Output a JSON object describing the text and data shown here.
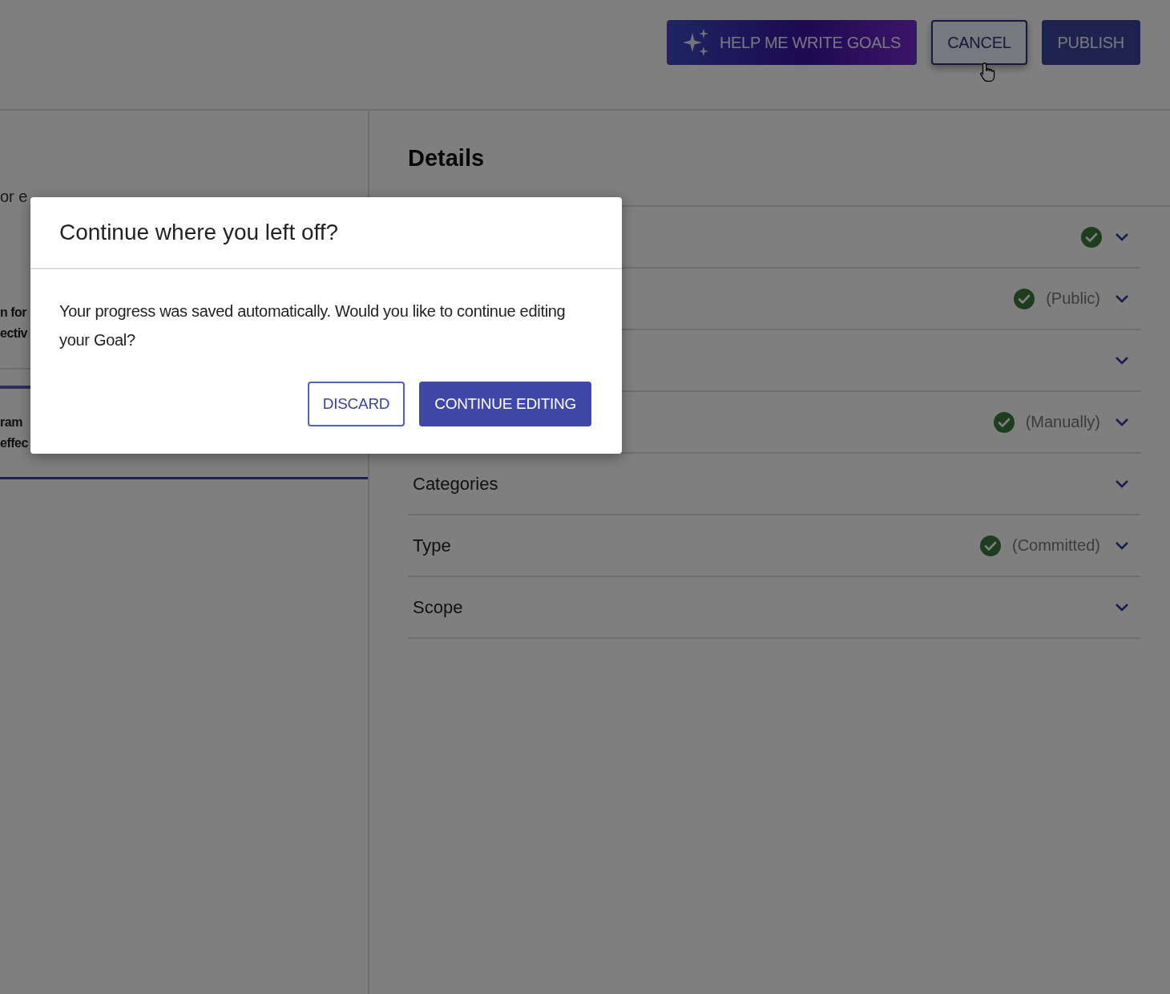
{
  "header": {
    "buttons": [
      {
        "kind": "ai",
        "label": "HELP ME WRITE GOALS",
        "hovered": false
      },
      {
        "kind": "outlined",
        "label": "CANCEL",
        "hovered": true
      },
      {
        "kind": "filled",
        "label": "PUBLISH",
        "hovered": false
      }
    ]
  },
  "left_panel": {
    "intro_text": "or e",
    "items": [
      {
        "lines": [
          "n for",
          "ectiv"
        ],
        "selected": false
      },
      {
        "lines": [
          "ram",
          "effec"
        ],
        "selected": true
      }
    ]
  },
  "details": {
    "title": "Details",
    "sections": [
      {
        "complete": true
      },
      {
        "complete": true,
        "value": "(Public)"
      },
      {
        "complete": false
      },
      {
        "complete": true,
        "value": "(Manually)"
      },
      {
        "title": "Categories",
        "complete": false
      },
      {
        "title": "Type",
        "complete": true,
        "value": "(Committed)"
      },
      {
        "title": "Scope",
        "complete": false
      }
    ]
  },
  "dialog": {
    "title": "Continue where you left off?",
    "message": "Your progress was saved automatically. Would you like to continue editing your Goal?",
    "buttons": [
      {
        "kind": "outlined",
        "label": "DISCARD"
      },
      {
        "kind": "filled",
        "label": "CONTINUE EDITING"
      }
    ]
  }
}
